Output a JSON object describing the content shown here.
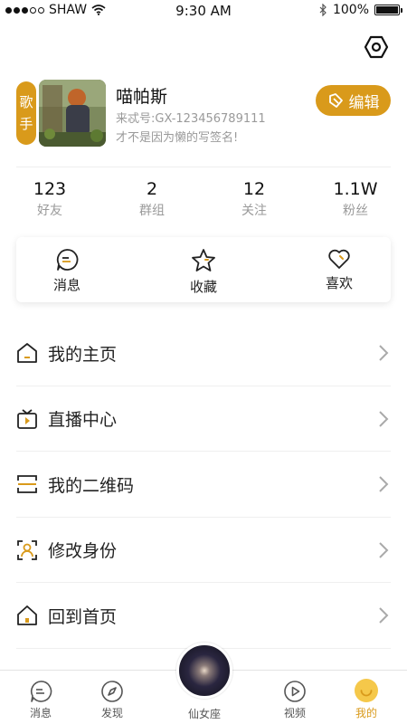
{
  "status_bar": {
    "carrier": "SHAW",
    "time": "9:30 AM",
    "battery": "100%",
    "battery_level": 1.0
  },
  "profile": {
    "tag_chars": [
      "歌",
      "手"
    ],
    "name": "喵帕斯",
    "id_text": "来忒号:GX-123456789111",
    "signature": "才不是因为懒的写签名!",
    "edit_label": "编辑"
  },
  "stats": [
    {
      "value": "123",
      "label": "好友"
    },
    {
      "value": "2",
      "label": "群组"
    },
    {
      "value": "12",
      "label": "关注"
    },
    {
      "value": "1.1W",
      "label": "粉丝"
    }
  ],
  "quick_actions": [
    {
      "label": "消息",
      "icon": "message-icon"
    },
    {
      "label": "收藏",
      "icon": "star-icon"
    },
    {
      "label": "喜欢",
      "icon": "heart-icon"
    }
  ],
  "menu": [
    {
      "label": "我的主页",
      "icon": "home-page-icon"
    },
    {
      "label": "直播中心",
      "icon": "tv-icon"
    },
    {
      "label": "我的二维码",
      "icon": "qr-scan-icon"
    },
    {
      "label": "修改身份",
      "icon": "id-person-icon"
    },
    {
      "label": "回到首页",
      "icon": "house-icon"
    }
  ],
  "tabbar": [
    {
      "label": "消息",
      "icon": "message-icon"
    },
    {
      "label": "发现",
      "icon": "compass-icon"
    },
    {
      "label": "仙女座",
      "icon": "andromeda-image"
    },
    {
      "label": "视频",
      "icon": "play-icon"
    },
    {
      "label": "我的",
      "icon": "smile-icon"
    }
  ],
  "colors": {
    "accent": "#d99a1b",
    "text": "#222222",
    "muted": "#9a9a9a"
  }
}
